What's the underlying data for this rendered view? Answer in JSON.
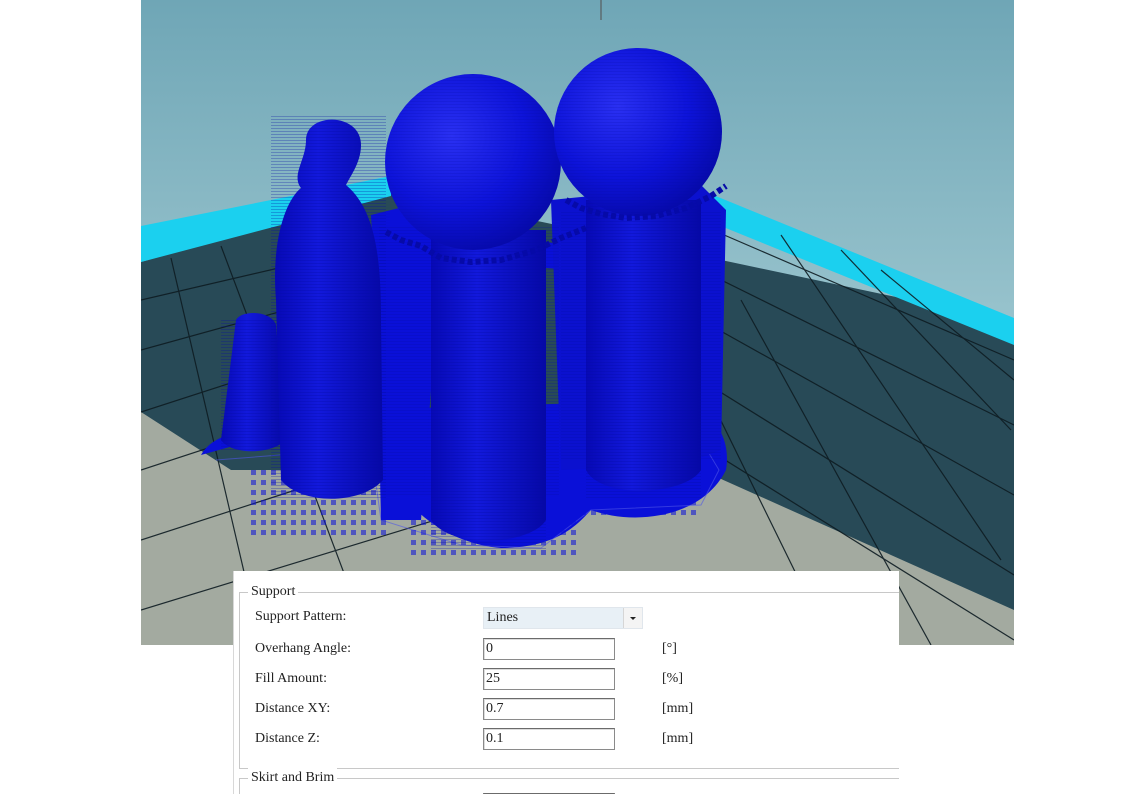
{
  "support": {
    "title": "Support",
    "pattern": {
      "label": "Support Pattern:",
      "value": "Lines"
    },
    "overhang_angle": {
      "label": "Overhang Angle:",
      "value": "0",
      "unit": "[°]"
    },
    "fill_amount": {
      "label": "Fill Amount:",
      "value": "25",
      "unit": "[%]"
    },
    "distance_xy": {
      "label": "Distance XY:",
      "value": "0.7",
      "unit": "[mm]"
    },
    "distance_z": {
      "label": "Distance Z:",
      "value": "0.1",
      "unit": "[mm]"
    }
  },
  "skirt_brim": {
    "title": "Skirt and Brim"
  },
  "viewport": {
    "model_color": "#0a10d8",
    "bed_stripe_color": "#1ad0ee",
    "sky_color": "#7fb1c0"
  }
}
